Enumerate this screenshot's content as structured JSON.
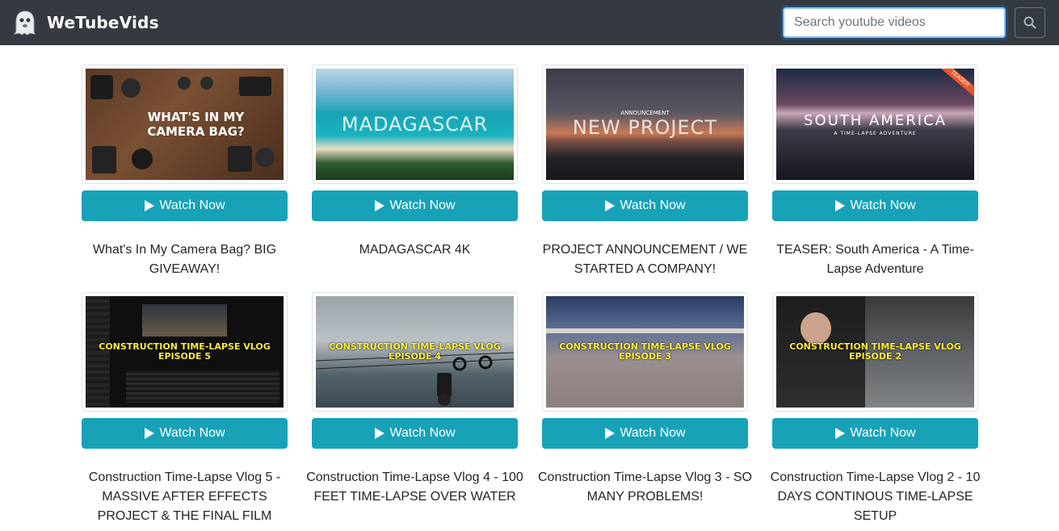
{
  "navbar": {
    "brand": "WeTubeVids",
    "search_placeholder": "Search youtube videos",
    "bg_color": "#343a40"
  },
  "button_color": "#17a2b8",
  "videos": [
    {
      "title": "What's In My Camera Bag? BIG GIVEAWAY!",
      "thumb_lines": [
        "WHAT'S IN MY",
        "CAMERA BAG?"
      ],
      "button": "Watch Now"
    },
    {
      "title": "MADAGASCAR 4K",
      "thumb_lines": [
        "MADAGASCAR"
      ],
      "button": "Watch Now"
    },
    {
      "title": "PROJECT ANNOUNCEMENT / WE STARTED A COMPANY!",
      "thumb_small": "ANNOUNCEMENT",
      "thumb_lines": [
        "NEW PROJECT"
      ],
      "button": "Watch Now"
    },
    {
      "title": "TEASER: South America - A Time-Lapse Adventure",
      "thumb_ribbon": "TEASER",
      "thumb_lines": [
        "SOUTH AMERICA"
      ],
      "thumb_small": "A TIME-LAPSE ADVENTURE",
      "button": "Watch Now"
    },
    {
      "title": "Construction Time-Lapse Vlog 5 - MASSIVE AFTER EFFECTS PROJECT & THE FINAL FILM",
      "thumb_lines": [
        "CONSTRUCTION TIME-LAPSE VLOG",
        "EPISODE 5"
      ],
      "button": "Watch Now"
    },
    {
      "title": "Construction Time-Lapse Vlog 4 - 100 FEET TIME-LAPSE OVER WATER",
      "thumb_lines": [
        "CONSTRUCTION TIME-LAPSE VLOG",
        "EPISODE 4"
      ],
      "button": "Watch Now"
    },
    {
      "title": "Construction Time-Lapse Vlog 3 - SO MANY PROBLEMS!",
      "thumb_lines": [
        "CONSTRUCTION TIME-LAPSE VLOG",
        "EPISODE 3"
      ],
      "button": "Watch Now"
    },
    {
      "title": "Construction Time-Lapse Vlog 2 - 10 DAYS CONTINOUS TIME-LAPSE SETUP",
      "thumb_lines": [
        "CONSTRUCTION TIME-LAPSE VLOG",
        "EPISODE 2"
      ],
      "button": "Watch Now"
    }
  ]
}
